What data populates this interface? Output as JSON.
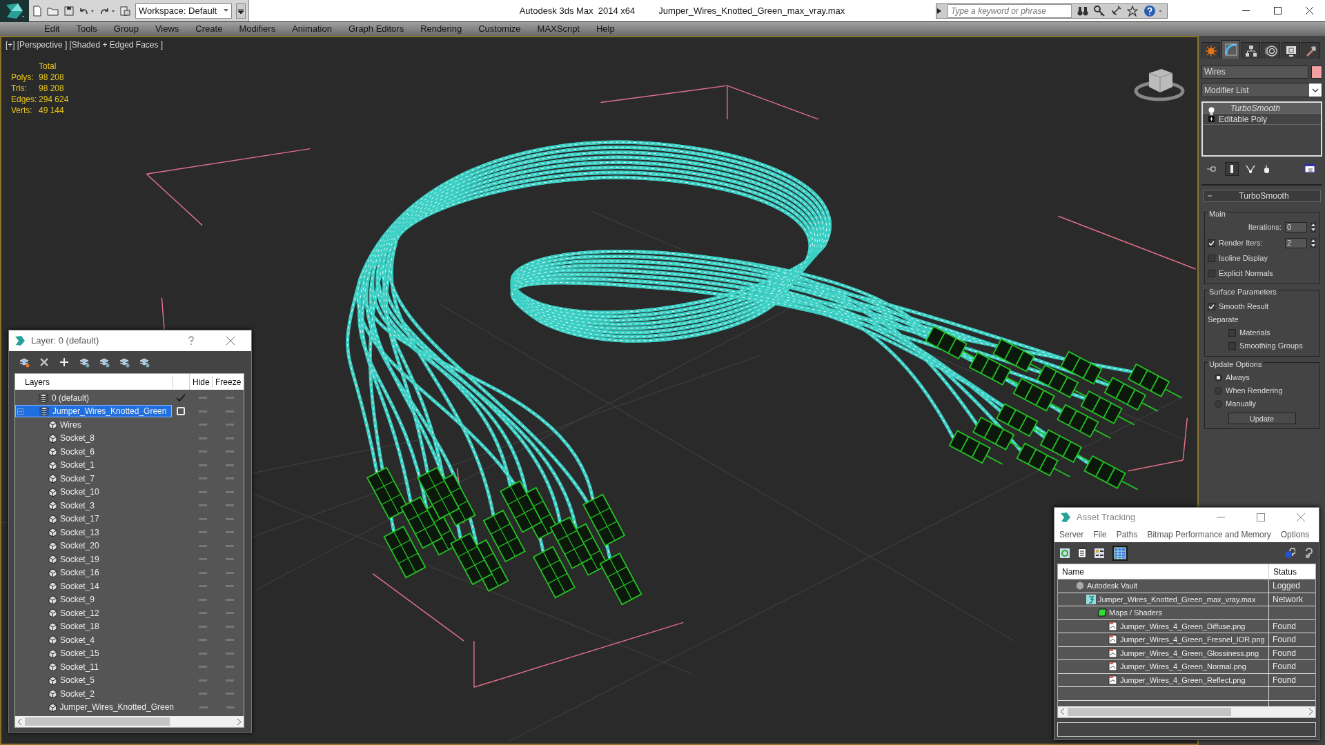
{
  "title_bar": {
    "workspace": "Workspace: Default",
    "title": "Autodesk 3ds Max  2014 x64",
    "file": "Jumper_Wires_Knotted_Green_max_vray.max",
    "search": {
      "placeholder": "Type a keyword or phrase"
    }
  },
  "menu": [
    "Edit",
    "Tools",
    "Group",
    "Views",
    "Create",
    "Modifiers",
    "Animation",
    "Graph Editors",
    "Rendering",
    "Customize",
    "MAXScript",
    "Help"
  ],
  "viewport": {
    "labels": [
      "[+]",
      "[Perspective ]",
      "[Shaded + Edged Faces ]"
    ],
    "stats": {
      "heading": "Total",
      "rows": [
        {
          "label": "Polys:",
          "value": "98 208"
        },
        {
          "label": "Tris:",
          "value": "98 208"
        },
        {
          "label": "Edges:",
          "value": "294 624"
        },
        {
          "label": "Verts:",
          "value": "49 144"
        }
      ]
    }
  },
  "command_panel": {
    "tabs": [
      {
        "kind": "create",
        "selected": false
      },
      {
        "kind": "modify",
        "selected": true
      },
      {
        "kind": "hierarchy",
        "selected": false
      },
      {
        "kind": "motion",
        "selected": false
      },
      {
        "kind": "display",
        "selected": false
      },
      {
        "kind": "utilities",
        "selected": false
      }
    ],
    "object_name": "Wires",
    "modifier_list": "Modifier List",
    "stack": [
      {
        "kind": "modifier",
        "name": "TurboSmooth",
        "selected": true
      },
      {
        "kind": "object",
        "name": "Editable Poly",
        "selected": false
      }
    ],
    "rollout": {
      "title": "TurboSmooth",
      "groups": [
        {
          "title": "Main",
          "controls": [
            {
              "kind": "spinner",
              "label": "Iterations:",
              "value": "0"
            },
            {
              "kind": "check_spinner",
              "label": "Render Iters:",
              "value": "2",
              "checked": true
            },
            {
              "kind": "checkbox",
              "label": "Isoline Display",
              "checked": false
            },
            {
              "kind": "checkbox",
              "label": "Explicit Normals",
              "checked": false
            }
          ]
        },
        {
          "title": "Surface Parameters",
          "controls": [
            {
              "kind": "checkbox",
              "label": "Smooth Result",
              "checked": true
            },
            {
              "kind": "text",
              "label": "Separate"
            },
            {
              "kind": "subcheckbox",
              "label": "Materials",
              "checked": false
            },
            {
              "kind": "subcheckbox",
              "label": "Smoothing Groups",
              "checked": false
            }
          ]
        },
        {
          "title": "Update Options",
          "controls": [
            {
              "kind": "radio",
              "label": "Always",
              "selected": true
            },
            {
              "kind": "radio",
              "label": "When Rendering",
              "selected": false
            },
            {
              "kind": "radio",
              "label": "Manually",
              "selected": false
            },
            {
              "kind": "button",
              "label": "Update"
            }
          ]
        }
      ]
    }
  },
  "layer_dialog": {
    "title": "Layer: 0 (default)",
    "columns": [
      "Layers",
      "Hide",
      "Freeze"
    ],
    "layers": [
      {
        "kind": "layer",
        "name": "0 (default)",
        "current": true,
        "selected": false
      },
      {
        "kind": "layer",
        "name": "Jumper_Wires_Knotted_Green",
        "current": false,
        "selected": true,
        "expanded": true,
        "children": [
          {
            "kind": "object",
            "name": "Wires"
          },
          {
            "kind": "object",
            "name": "Socket_8"
          },
          {
            "kind": "object",
            "name": "Socket_6"
          },
          {
            "kind": "object",
            "name": "Socket_1"
          },
          {
            "kind": "object",
            "name": "Socket_7"
          },
          {
            "kind": "object",
            "name": "Socket_10"
          },
          {
            "kind": "object",
            "name": "Socket_3"
          },
          {
            "kind": "object",
            "name": "Socket_17"
          },
          {
            "kind": "object",
            "name": "Socket_13"
          },
          {
            "kind": "object",
            "name": "Socket_20"
          },
          {
            "kind": "object",
            "name": "Socket_19"
          },
          {
            "kind": "object",
            "name": "Socket_16"
          },
          {
            "kind": "object",
            "name": "Socket_14"
          },
          {
            "kind": "object",
            "name": "Socket_9"
          },
          {
            "kind": "object",
            "name": "Socket_12"
          },
          {
            "kind": "object",
            "name": "Socket_18"
          },
          {
            "kind": "object",
            "name": "Socket_4"
          },
          {
            "kind": "object",
            "name": "Socket_15"
          },
          {
            "kind": "object",
            "name": "Socket_11"
          },
          {
            "kind": "object",
            "name": "Socket_5"
          },
          {
            "kind": "object",
            "name": "Socket_2"
          },
          {
            "kind": "object",
            "name": "Jumper_Wires_Knotted_Green"
          }
        ]
      }
    ]
  },
  "asset_tracking": {
    "title": "Asset Tracking",
    "menu": [
      "Server",
      "File",
      "Paths",
      "Bitmap Performance and Memory",
      "Options"
    ],
    "columns": [
      "Name",
      "Status"
    ],
    "rows": [
      {
        "kind": "vault",
        "name": "Autodesk Vault",
        "status": "Logged",
        "children": [
          {
            "kind": "scene",
            "name": "Jumper_Wires_Knotted_Green_max_vray.max",
            "status": "Network",
            "children": [
              {
                "kind": "folder",
                "name": "Maps / Shaders",
                "children": [
                  {
                    "kind": "bitmap",
                    "name": "Jumper_Wires_4_Green_Diffuse.png",
                    "status": "Found"
                  },
                  {
                    "kind": "bitmap",
                    "name": "Jumper_Wires_4_Green_Fresnel_IOR.png",
                    "status": "Found"
                  },
                  {
                    "kind": "bitmap",
                    "name": "Jumper_Wires_4_Green_Glossiness.png",
                    "status": "Found"
                  },
                  {
                    "kind": "bitmap",
                    "name": "Jumper_Wires_4_Green_Normal.png",
                    "status": "Found"
                  },
                  {
                    "kind": "bitmap",
                    "name": "Jumper_Wires_4_Green_Reflect.png",
                    "status": "Found"
                  }
                ]
              }
            ]
          }
        ]
      }
    ]
  }
}
